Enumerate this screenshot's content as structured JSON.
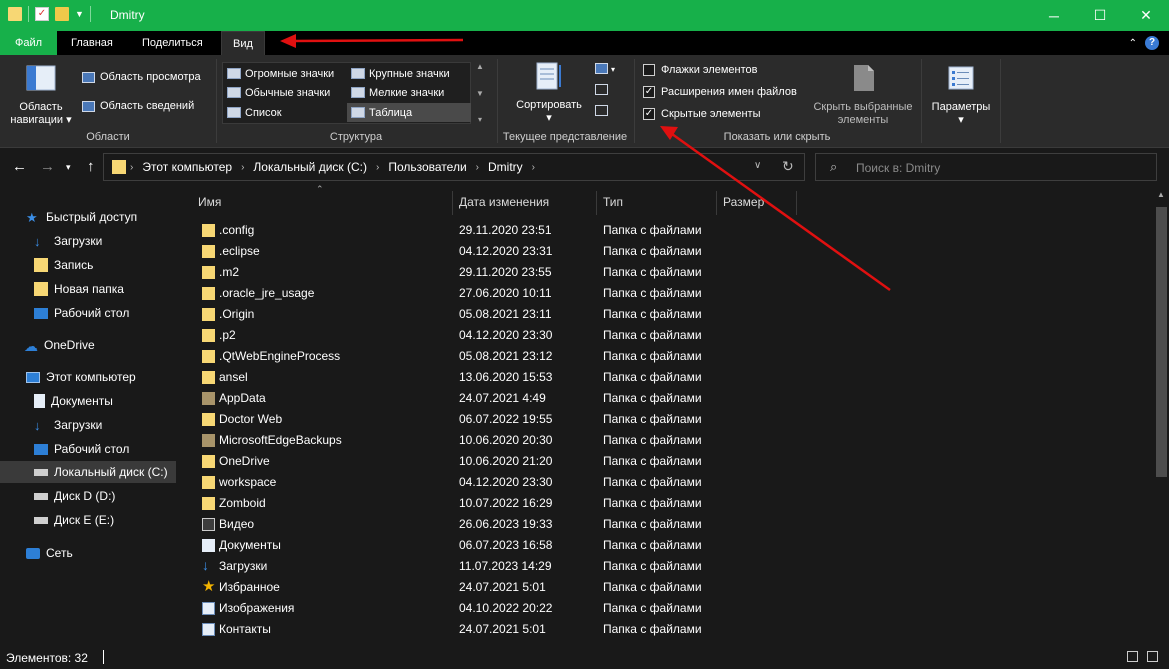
{
  "window": {
    "title": "Dmitry",
    "controls": [
      "─",
      "☐",
      "✕"
    ]
  },
  "menu": {
    "tabs": [
      "Файл",
      "Главная",
      "Поделиться",
      "Вид"
    ],
    "active": "Вид"
  },
  "ribbon": {
    "panes": {
      "nav_label_1": "Область",
      "nav_label_2": "навигации",
      "preview": "Область просмотра",
      "details": "Область сведений",
      "group": "Области"
    },
    "layout": {
      "items": [
        "Огромные значки",
        "Крупные значки",
        "Обычные значки",
        "Мелкие значки",
        "Список",
        "Таблица"
      ],
      "selected": "Таблица",
      "group": "Структура"
    },
    "current_view": {
      "sort": "Сортировать",
      "group": "Текущее представление"
    },
    "show_hide": {
      "checkboxes": [
        {
          "label": "Флажки элементов",
          "checked": false
        },
        {
          "label": "Расширения имен файлов",
          "checked": true
        },
        {
          "label": "Скрытые элементы",
          "checked": true
        }
      ],
      "hide_selected_1": "Скрыть выбранные",
      "hide_selected_2": "элементы",
      "group": "Показать или скрыть"
    },
    "options": {
      "label": "Параметры"
    }
  },
  "address": {
    "crumbs": [
      "Этот компьютер",
      "Локальный диск (C:)",
      "Пользователи",
      "Dmitry"
    ]
  },
  "search": {
    "placeholder": "Поиск в: Dmitry"
  },
  "sidebar": {
    "items": [
      {
        "label": "Быстрый доступ",
        "icon": "star-icon",
        "level": 0
      },
      {
        "label": "Загрузки",
        "icon": "download-icon",
        "level": 1
      },
      {
        "label": "Запись",
        "icon": "folder-icon",
        "level": 1
      },
      {
        "label": "Новая папка",
        "icon": "folder-icon",
        "level": 1
      },
      {
        "label": "Рабочий стол",
        "icon": "desktop-icon",
        "level": 1
      },
      {
        "label": "OneDrive",
        "icon": "cloud-icon",
        "level": 0
      },
      {
        "label": "Этот компьютер",
        "icon": "computer-icon",
        "level": 0
      },
      {
        "label": "Документы",
        "icon": "document-icon",
        "level": 1
      },
      {
        "label": "Загрузки",
        "icon": "download-icon",
        "level": 1
      },
      {
        "label": "Рабочий стол",
        "icon": "desktop-icon",
        "level": 1
      },
      {
        "label": "Локальный диск (C:)",
        "icon": "drive-icon",
        "level": 1,
        "selected": true
      },
      {
        "label": "Диск D (D:)",
        "icon": "drive-icon",
        "level": 1
      },
      {
        "label": "Диск E (E:)",
        "icon": "drive-icon",
        "level": 1
      },
      {
        "label": "Сеть",
        "icon": "network-icon",
        "level": 0
      }
    ]
  },
  "columns": [
    "Имя",
    "Дата изменения",
    "Тип",
    "Размер"
  ],
  "files": [
    {
      "name": ".config",
      "date": "29.11.2020 23:51",
      "type": "Папка с файлами",
      "icon": "folder-icon"
    },
    {
      "name": ".eclipse",
      "date": "04.12.2020 23:31",
      "type": "Папка с файлами",
      "icon": "folder-icon"
    },
    {
      "name": ".m2",
      "date": "29.11.2020 23:55",
      "type": "Папка с файлами",
      "icon": "folder-icon"
    },
    {
      "name": ".oracle_jre_usage",
      "date": "27.06.2020 10:11",
      "type": "Папка с файлами",
      "icon": "folder-icon"
    },
    {
      "name": ".Origin",
      "date": "05.08.2021 23:11",
      "type": "Папка с файлами",
      "icon": "folder-icon"
    },
    {
      "name": ".p2",
      "date": "04.12.2020 23:30",
      "type": "Папка с файлами",
      "icon": "folder-icon"
    },
    {
      "name": ".QtWebEngineProcess",
      "date": "05.08.2021 23:12",
      "type": "Папка с файлами",
      "icon": "folder-icon"
    },
    {
      "name": "ansel",
      "date": "13.06.2020 15:53",
      "type": "Папка с файлами",
      "icon": "folder-icon"
    },
    {
      "name": "AppData",
      "date": "24.07.2021 4:49",
      "type": "Папка с файлами",
      "icon": "hidden-folder-icon"
    },
    {
      "name": "Doctor Web",
      "date": "06.07.2022 19:55",
      "type": "Папка с файлами",
      "icon": "folder-icon"
    },
    {
      "name": "MicrosoftEdgeBackups",
      "date": "10.06.2020 20:30",
      "type": "Папка с файлами",
      "icon": "hidden-folder-icon"
    },
    {
      "name": "OneDrive",
      "date": "10.06.2020 21:20",
      "type": "Папка с файлами",
      "icon": "folder-icon"
    },
    {
      "name": "workspace",
      "date": "04.12.2020 23:30",
      "type": "Папка с файлами",
      "icon": "folder-icon"
    },
    {
      "name": "Zomboid",
      "date": "10.07.2022 16:29",
      "type": "Папка с файлами",
      "icon": "folder-icon"
    },
    {
      "name": "Видео",
      "date": "26.06.2023 19:33",
      "type": "Папка с файлами",
      "icon": "video-folder-icon"
    },
    {
      "name": "Документы",
      "date": "06.07.2023 16:58",
      "type": "Папка с файлами",
      "icon": "document-icon"
    },
    {
      "name": "Загрузки",
      "date": "11.07.2023 14:29",
      "type": "Папка с файлами",
      "icon": "download-icon"
    },
    {
      "name": "Избранное",
      "date": "24.07.2021 5:01",
      "type": "Папка с файлами",
      "icon": "star-icon"
    },
    {
      "name": "Изображения",
      "date": "04.10.2022 20:22",
      "type": "Папка с файлами",
      "icon": "pictures-icon"
    },
    {
      "name": "Контакты",
      "date": "24.07.2021 5:01",
      "type": "Папка с файлами",
      "icon": "contacts-icon"
    }
  ],
  "status": {
    "count": "Элементов: 32"
  },
  "colors": {
    "titlebar": "#17b04a",
    "background": "#191919",
    "ribbon": "#2b2b2b",
    "annotation_arrow": "#e01010",
    "folder": "#f7d774"
  }
}
